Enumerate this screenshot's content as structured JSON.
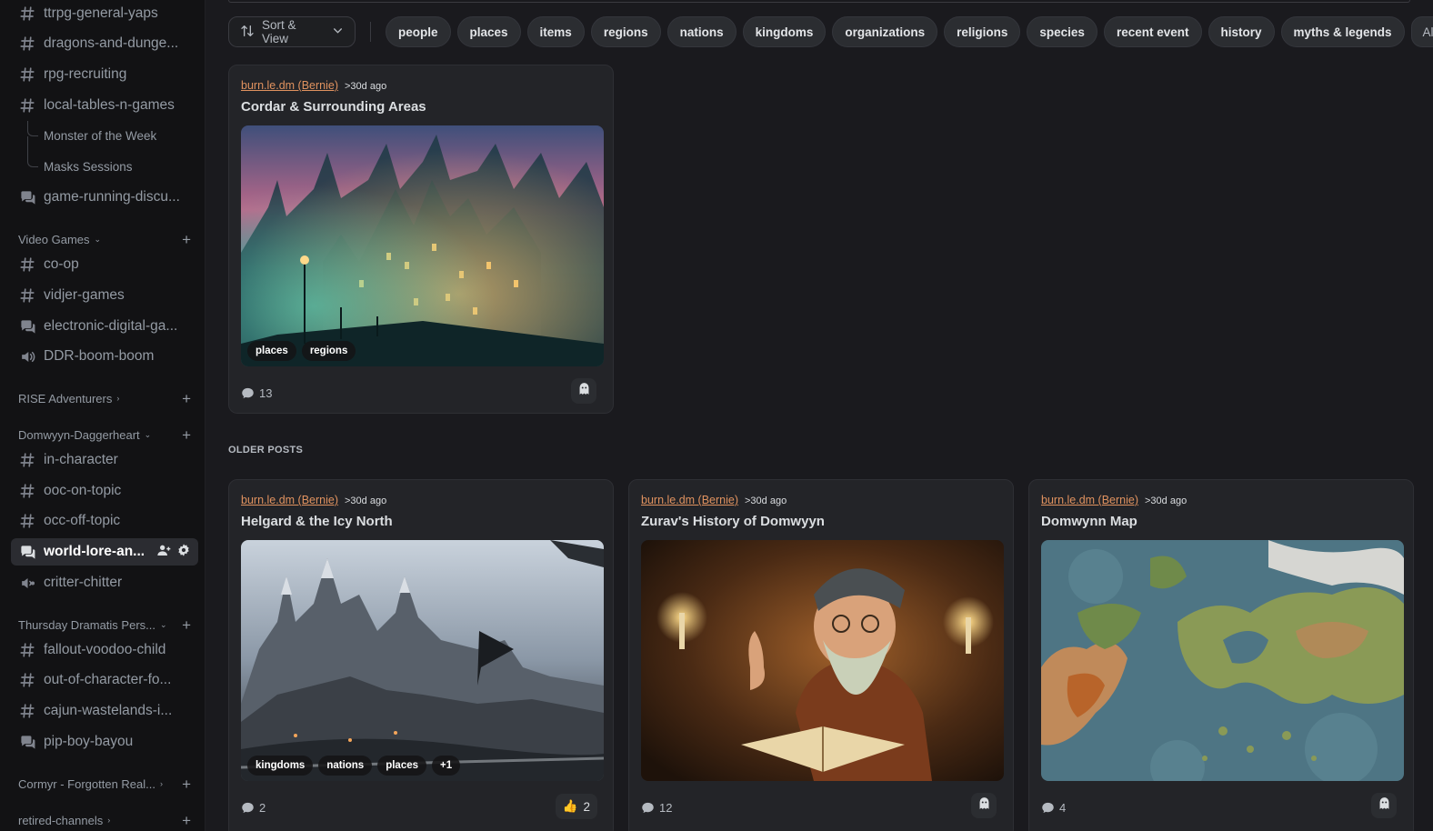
{
  "sidebar": {
    "top_channels": [
      {
        "label": "ttrpg-general-yaps",
        "type": "text"
      },
      {
        "label": "dragons-and-dunge...",
        "type": "text"
      },
      {
        "label": "rpg-recruiting",
        "type": "text"
      },
      {
        "label": "local-tables-n-games",
        "type": "text"
      }
    ],
    "threads": [
      "Monster of the Week",
      "Masks Sessions"
    ],
    "game_running": {
      "label": "game-running-discu...",
      "type": "forum"
    },
    "categories": [
      {
        "name": "Video Games",
        "expanded": true,
        "channels": [
          {
            "label": "co-op",
            "type": "text"
          },
          {
            "label": "vidjer-games",
            "type": "text"
          },
          {
            "label": "electronic-digital-ga...",
            "type": "forum"
          },
          {
            "label": "DDR-boom-boom",
            "type": "voice"
          }
        ]
      },
      {
        "name": "RISE Adventurers",
        "expanded": false,
        "channels": []
      },
      {
        "name": "Domwyyn-Daggerheart",
        "expanded": true,
        "channels": [
          {
            "label": "in-character",
            "type": "text"
          },
          {
            "label": "ooc-on-topic",
            "type": "text"
          },
          {
            "label": "occ-off-topic",
            "type": "text"
          },
          {
            "label": "world-lore-an...",
            "type": "forum",
            "active": true
          },
          {
            "label": "critter-chitter",
            "type": "stage"
          }
        ]
      },
      {
        "name": "Thursday Dramatis Pers...",
        "expanded": true,
        "channels": [
          {
            "label": "fallout-voodoo-child",
            "type": "text"
          },
          {
            "label": "out-of-character-fo...",
            "type": "text"
          },
          {
            "label": "cajun-wastelands-i...",
            "type": "text"
          },
          {
            "label": "pip-boy-bayou",
            "type": "forum"
          }
        ]
      },
      {
        "name": "Cormyr - Forgotten Real...",
        "expanded": false,
        "channels": []
      },
      {
        "name": "retired-channels",
        "expanded": false,
        "channels": []
      }
    ]
  },
  "main": {
    "sort_label": "Sort & View",
    "tags": [
      "people",
      "places",
      "items",
      "regions",
      "nations",
      "kingdoms",
      "organizations",
      "religions",
      "species",
      "recent event",
      "history",
      "myths & legends"
    ],
    "all_label": "All",
    "section_label": "OLDER POSTS",
    "posts": [
      {
        "author": "burn.le.dm (Bernie)",
        "time": ">30d ago",
        "title": "Cordar & Surrounding Areas",
        "tags": [
          "places",
          "regions"
        ],
        "comments": "13",
        "image": "fantasy-city-night"
      },
      {
        "author": "burn.le.dm (Bernie)",
        "time": ">30d ago",
        "title": "Helgard & the Icy North",
        "tags": [
          "kingdoms",
          "nations",
          "places",
          "+1"
        ],
        "comments": "2",
        "reaction": {
          "emoji": "👍",
          "count": "2"
        },
        "image": "snowy-castle"
      },
      {
        "author": "burn.le.dm (Bernie)",
        "time": ">30d ago",
        "title": "Zurav's History of Domwyyn",
        "tags": [],
        "comments": "12",
        "image": "gnome-scholar"
      },
      {
        "author": "burn.le.dm (Bernie)",
        "time": ">30d ago",
        "title": "Domwynn Map",
        "tags": [],
        "comments": "4",
        "image": "world-map"
      }
    ]
  },
  "colors": {
    "background": "#1a1a1e",
    "sidebar": "#121214",
    "card": "#232428",
    "author_link": "#e0925f",
    "tag_pill": "#2b2d31"
  }
}
